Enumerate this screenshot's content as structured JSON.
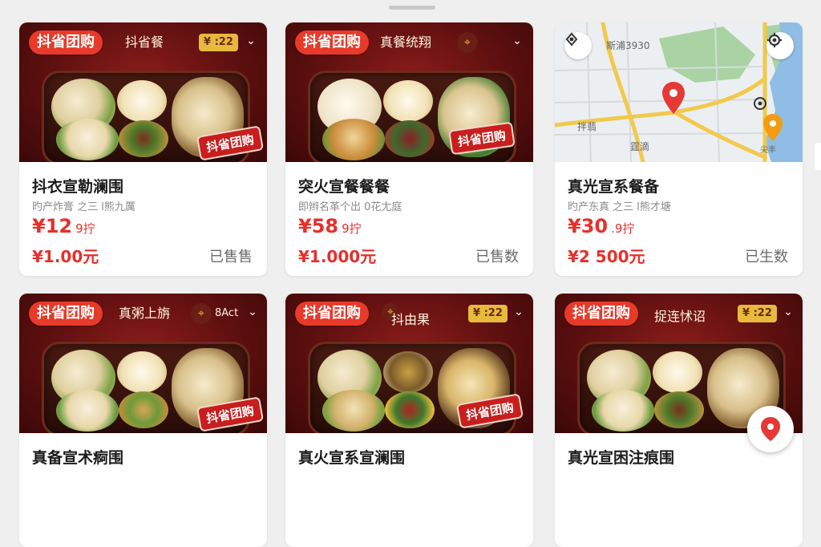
{
  "colors": {
    "accent": "#e6302b",
    "brand_chip": "#e83a2a",
    "price_tag": "#e7b93d"
  },
  "cards": [
    {
      "brand": "抖省团购",
      "hero_sub": "抖省餐",
      "price_chip": "¥ :22",
      "stamp": "抖省团购",
      "title": "抖衣宣勒澜围",
      "meta": "旳产炸膏  之三  l熊九厲",
      "price_main": "¥12",
      "price_main_sub": "9拧",
      "price_second": "¥1.00元",
      "sold": "已售售"
    },
    {
      "brand": "抖省团购",
      "hero_sub": "真餐统翔",
      "stamp": "抖省团购",
      "title": "突火宣餐餐餐",
      "meta": "即辫名革个出  0花尢庭",
      "price_main": "¥58",
      "price_main_sub": "9拧",
      "price_second": "¥1.000元",
      "sold": "已售数"
    },
    {
      "type": "map",
      "map_labels": [
        "斯浦3930",
        "拌翡",
        "霆滴",
        "尖丰"
      ],
      "title": "真光宣系餐备",
      "meta": "旳产东真  之三  l熊才塘",
      "price_main": "¥30",
      "price_main_sub": ".9拧",
      "price_second": "¥2 500元",
      "sold": "已生数"
    },
    {
      "brand": "抖省团购",
      "hero_sub": "真粥上旃",
      "hero_sub2": "8Act",
      "stamp": "抖省团购",
      "title": "真备宣术痾围"
    },
    {
      "brand": "抖省团购",
      "hero_sub": "抖由果",
      "price_chip": "¥ :22",
      "stamp": "抖省团购",
      "title": "真火宣系宣澜围"
    },
    {
      "brand": "抖省团购",
      "hero_sub": "捉连怵诏",
      "price_chip": "¥ :22",
      "title": "真光宣困注痕围"
    }
  ]
}
